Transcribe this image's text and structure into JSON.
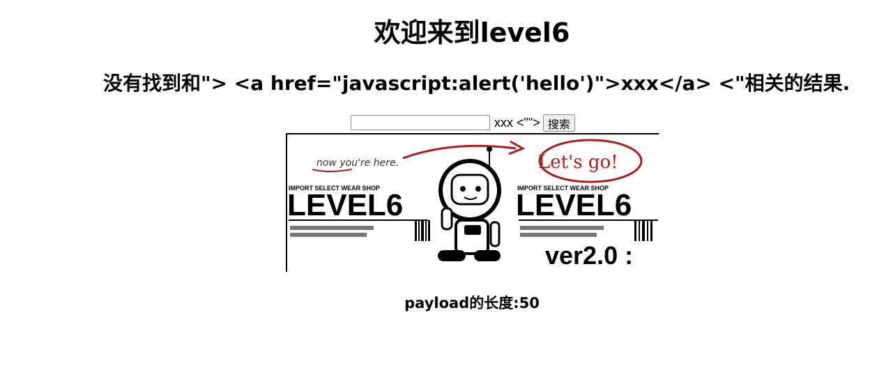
{
  "page": {
    "title": "欢迎来到level6",
    "result_text": "没有找到和\"> <a href=\"javascript:alert('hello')\">xxx</a> <\"相关的结果.",
    "payload_label": "payload的长度:50"
  },
  "search": {
    "input_value": "",
    "trailing_text": "xxx <\"\">",
    "button_label": "搜索"
  },
  "banner": {
    "note_left": "now you're here.",
    "note_right": "Let's go!",
    "shop_left": "IMPORT SELECT WEAR SHOP",
    "shop_right": "IMPORT SELECT WEAR SHOP",
    "level_left": "LEVEL6",
    "level_right": "LEVEL6",
    "version": "ver2.0 :"
  }
}
